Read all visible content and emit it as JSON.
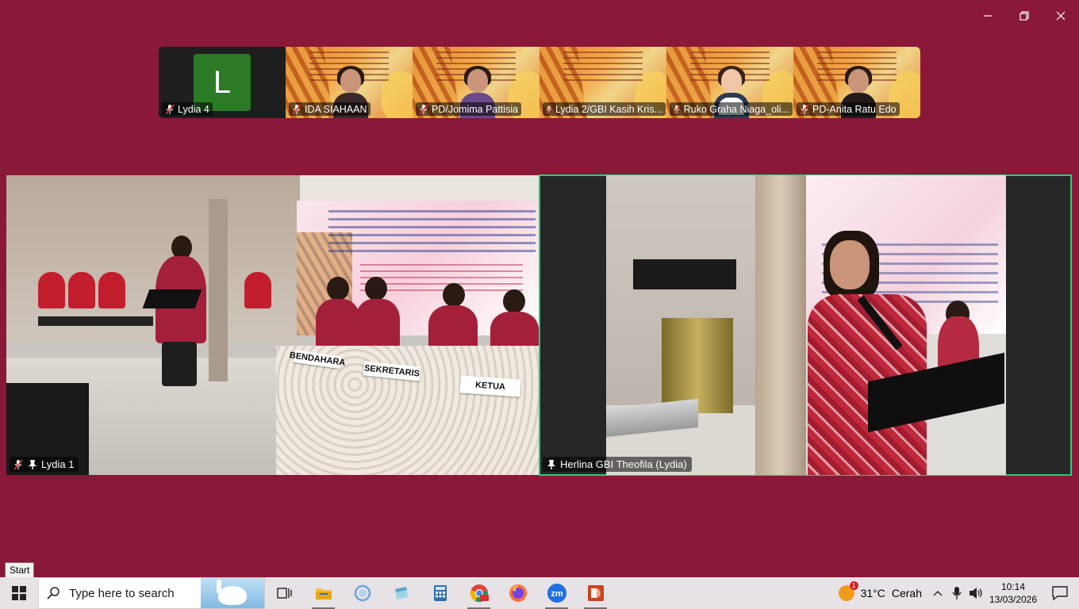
{
  "window": {
    "minimize": "minimize",
    "restore": "restore",
    "close": "close"
  },
  "gallery": [
    {
      "name": "Lydia 4",
      "avatar_letter": "L",
      "kind": "avatar",
      "muted": true
    },
    {
      "name": "IDA SIAHAAN",
      "kind": "video",
      "muted": true
    },
    {
      "name": "PD/Jomima Pattisia",
      "kind": "video",
      "muted": true
    },
    {
      "name": "Lydia 2/GBI Kasih Kris...",
      "kind": "video",
      "muted": true
    },
    {
      "name": "Ruko Graha Niaga_oli...",
      "kind": "video",
      "muted": true
    },
    {
      "name": "PD-Anita Ratu Edo",
      "kind": "video",
      "muted": true
    }
  ],
  "main": {
    "left": {
      "name": "Lydia 1",
      "muted": true,
      "pinned": true,
      "scene_text": {
        "plate1": "BENDAHARA",
        "plate2": "SEKRETARIS",
        "plate3": "KETUA"
      }
    },
    "right": {
      "name": "Herlina GBI Theofila (Lydia)",
      "pinned": true,
      "active_speaker": true
    }
  },
  "tooltip": "Start",
  "taskbar": {
    "search_placeholder": "Type here to search",
    "apps": [
      "task-view",
      "file-explorer",
      "cortana",
      "notepad",
      "calculator",
      "chrome",
      "firefox",
      "zoom",
      "powerpoint"
    ],
    "active_app": "zoom",
    "weather": {
      "temp": "31°C",
      "condition": "Cerah",
      "badge": "1"
    },
    "time": "10:14",
    "date": "13/03/2026"
  },
  "colors": {
    "background": "#8a1838",
    "active_speaker_border": "#24d078",
    "taskbar": "#e7e2e6"
  }
}
